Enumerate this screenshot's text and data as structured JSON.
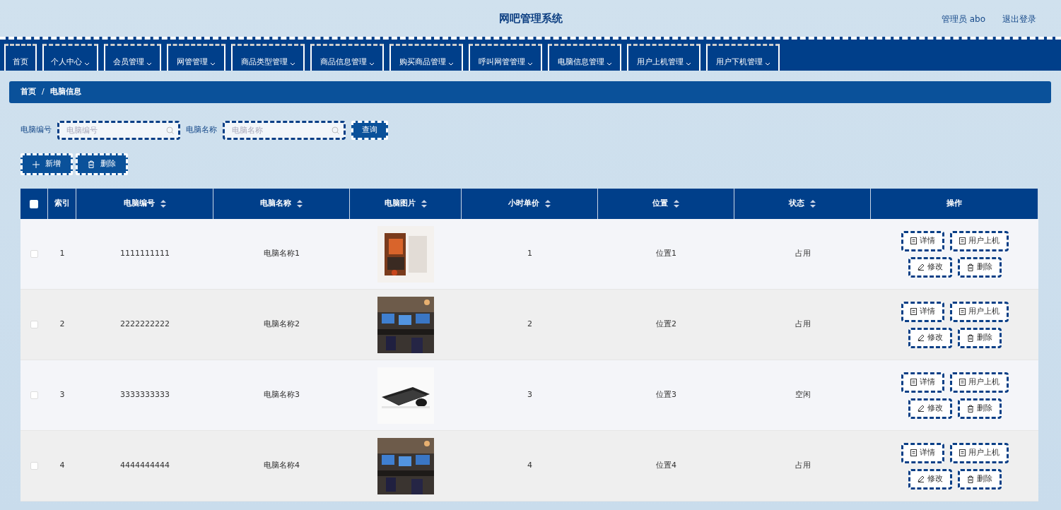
{
  "header": {
    "title": "网吧管理系统",
    "user": "管理员 abo",
    "logout": "退出登录"
  },
  "nav": [
    {
      "label": "首页",
      "dropdown": false
    },
    {
      "label": "个人中心",
      "dropdown": true
    },
    {
      "label": "会员管理",
      "dropdown": true
    },
    {
      "label": "网管管理",
      "dropdown": true
    },
    {
      "label": "商品类型管理",
      "dropdown": true
    },
    {
      "label": "商品信息管理",
      "dropdown": true
    },
    {
      "label": "购买商品管理",
      "dropdown": true
    },
    {
      "label": "呼叫网管管理",
      "dropdown": true
    },
    {
      "label": "电脑信息管理",
      "dropdown": true
    },
    {
      "label": "用户上机管理",
      "dropdown": true
    },
    {
      "label": "用户下机管理",
      "dropdown": true
    }
  ],
  "breadcrumb": {
    "items": [
      "首页",
      "电脑信息"
    ],
    "separator": "/"
  },
  "search": {
    "fields": [
      {
        "label": "电脑编号",
        "placeholder": "电脑编号"
      },
      {
        "label": "电脑名称",
        "placeholder": "电脑名称"
      }
    ],
    "button": "查询"
  },
  "toolbar": [
    {
      "label": "新增"
    },
    {
      "label": "删除"
    }
  ],
  "table": {
    "select_all": {
      "checked": false
    },
    "columns": [
      {
        "label": "索引",
        "sortable": false
      },
      {
        "label": "电脑编号",
        "sortable": true
      },
      {
        "label": "电脑名称",
        "sortable": true
      },
      {
        "label": "电脑图片",
        "sortable": true
      },
      {
        "label": "小时单价",
        "sortable": true
      },
      {
        "label": "位置",
        "sortable": true
      },
      {
        "label": "状态",
        "sortable": true
      },
      {
        "label": "操作",
        "sortable": false
      }
    ],
    "rows": [
      {
        "checked": false,
        "index": "1",
        "code": "1111111111",
        "name": "电脑名称1",
        "price": "1",
        "location": "位置1",
        "status": "占用",
        "actions": [
          {
            "label": "详情"
          },
          {
            "label": "用户上机"
          },
          {
            "label": "修改"
          },
          {
            "label": "删除"
          }
        ]
      },
      {
        "checked": false,
        "index": "2",
        "code": "2222222222",
        "name": "电脑名称2",
        "price": "2",
        "location": "位置2",
        "status": "占用",
        "actions": [
          {
            "label": "详情"
          },
          {
            "label": "用户上机"
          },
          {
            "label": "修改"
          },
          {
            "label": "删除"
          }
        ]
      },
      {
        "checked": false,
        "index": "3",
        "code": "3333333333",
        "name": "电脑名称3",
        "price": "3",
        "location": "位置3",
        "status": "空闲",
        "actions": [
          {
            "label": "详情"
          },
          {
            "label": "用户上机"
          },
          {
            "label": "修改"
          },
          {
            "label": "删除"
          }
        ]
      },
      {
        "checked": false,
        "index": "4",
        "code": "4444444444",
        "name": "电脑名称4",
        "price": "4",
        "location": "位置4",
        "status": "占用",
        "actions": [
          {
            "label": "详情"
          },
          {
            "label": "用户上机"
          },
          {
            "label": "修改"
          },
          {
            "label": "删除"
          }
        ]
      }
    ]
  }
}
